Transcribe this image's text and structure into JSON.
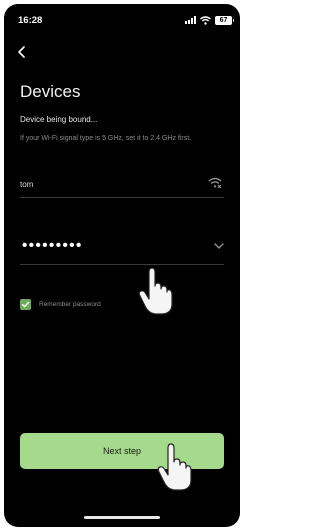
{
  "status_bar": {
    "time": "16:28",
    "battery": "67",
    "icons": [
      "signal-icon",
      "wifi-icon",
      "battery-icon"
    ]
  },
  "header": {
    "back_icon": "chevron-left-icon",
    "title": "Devices"
  },
  "content": {
    "status": "Device being bound...",
    "hint": "If your Wi-Fi signal type is 5 GHz, set it to 2.4 GHz first."
  },
  "form": {
    "ssid": {
      "value": "tom",
      "icon": "wifi-icon"
    },
    "password": {
      "value": "•••••••••",
      "icon": "chevron-down-icon"
    },
    "remember": {
      "label": "Remember password",
      "checked": true
    }
  },
  "actions": {
    "next_label": "Next step"
  },
  "overlay": {
    "icons": [
      "hand-pointer-icon",
      "hand-pointer-icon"
    ]
  },
  "colors": {
    "background": "#000000",
    "accent": "#a5d98c",
    "checkbox": "#6fa95a",
    "hint": "#8c8c8c"
  }
}
